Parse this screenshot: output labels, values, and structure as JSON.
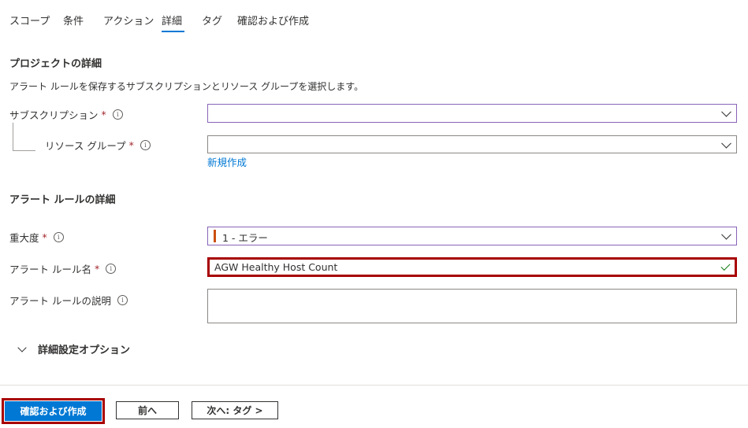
{
  "tabs": {
    "scope": "スコープ",
    "conditions": "条件",
    "actions": "アクション",
    "details": "詳細",
    "tags": "タグ",
    "review": "確認および作成"
  },
  "project_details": {
    "title": "プロジェクトの詳細",
    "description": "アラート ルールを保存するサブスクリプションとリソース グループを選択します。",
    "subscription_label": "サブスクリプション",
    "subscription_value": "",
    "resource_group_label": "リソース グループ",
    "resource_group_value": "",
    "create_new_link": "新規作成"
  },
  "alert_rule_details": {
    "title": "アラート ルールの詳細",
    "severity_label": "重大度",
    "severity_value": "1 - エラー",
    "severity_color": "#ca5010",
    "rule_name_label": "アラート ルール名",
    "rule_name_value": "AGW Healthy Host Count",
    "rule_description_label": "アラート ルールの説明",
    "rule_description_value": ""
  },
  "advanced": {
    "label": "詳細設定オプション"
  },
  "required_mark": "*",
  "info_glyph": "i",
  "footer": {
    "review_create": "確認および作成",
    "previous": "前へ",
    "next": "次へ: タグ >"
  },
  "colors": {
    "accent": "#0078d4",
    "highlight_border": "#a80000",
    "required": "#a4262c"
  }
}
